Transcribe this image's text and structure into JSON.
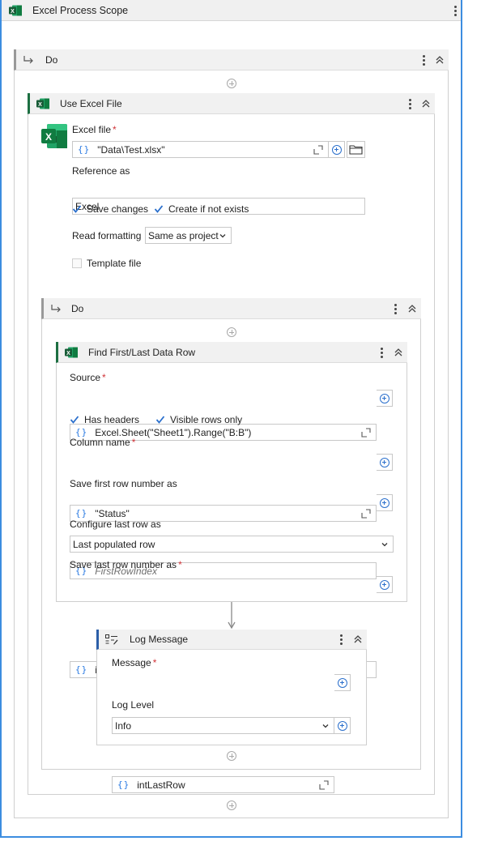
{
  "scope": {
    "title": "Excel Process Scope"
  },
  "outer_do": {
    "label": "Do"
  },
  "use_excel": {
    "title": "Use Excel File",
    "excel_file_label": "Excel file",
    "excel_file_value": "\"Data\\Test.xlsx\"",
    "reference_label": "Reference as",
    "reference_value": "Excel",
    "save_changes": {
      "label": "Save changes",
      "checked": true
    },
    "create_if_not_exists": {
      "label": "Create if not exists",
      "checked": true
    },
    "read_formatting_label": "Read formatting",
    "read_formatting_value": "Same as project",
    "template_file": {
      "label": "Template file",
      "checked": false
    }
  },
  "inner_do": {
    "label": "Do"
  },
  "find_row": {
    "title": "Find First/Last Data Row",
    "source_label": "Source",
    "source_value": "Excel.Sheet(\"Sheet1\").Range(\"B:B\")",
    "has_headers": {
      "label": "Has headers",
      "checked": true
    },
    "visible_rows_only": {
      "label": "Visible rows only",
      "checked": true
    },
    "column_name_label": "Column name",
    "column_name_value": "\"Status\"",
    "save_first_label": "Save first row number as",
    "save_first_placeholder": "FirstRowIndex",
    "configure_last_label": "Configure last row as",
    "configure_last_value": "Last populated row",
    "save_last_label": "Save last row number as",
    "save_last_value": "intLastRow"
  },
  "log_message": {
    "title": "Log Message",
    "message_label": "Message",
    "message_value": "intLastRow",
    "log_level_label": "Log Level",
    "log_level_value": "Info"
  },
  "required_marker": "*",
  "brace_symbol": "{}",
  "colors": {
    "accent_blue": "#3c8de0",
    "excel_green": "#1d6f42",
    "required_red": "#d13438",
    "checkbox_blue": "#2a6fcc"
  }
}
